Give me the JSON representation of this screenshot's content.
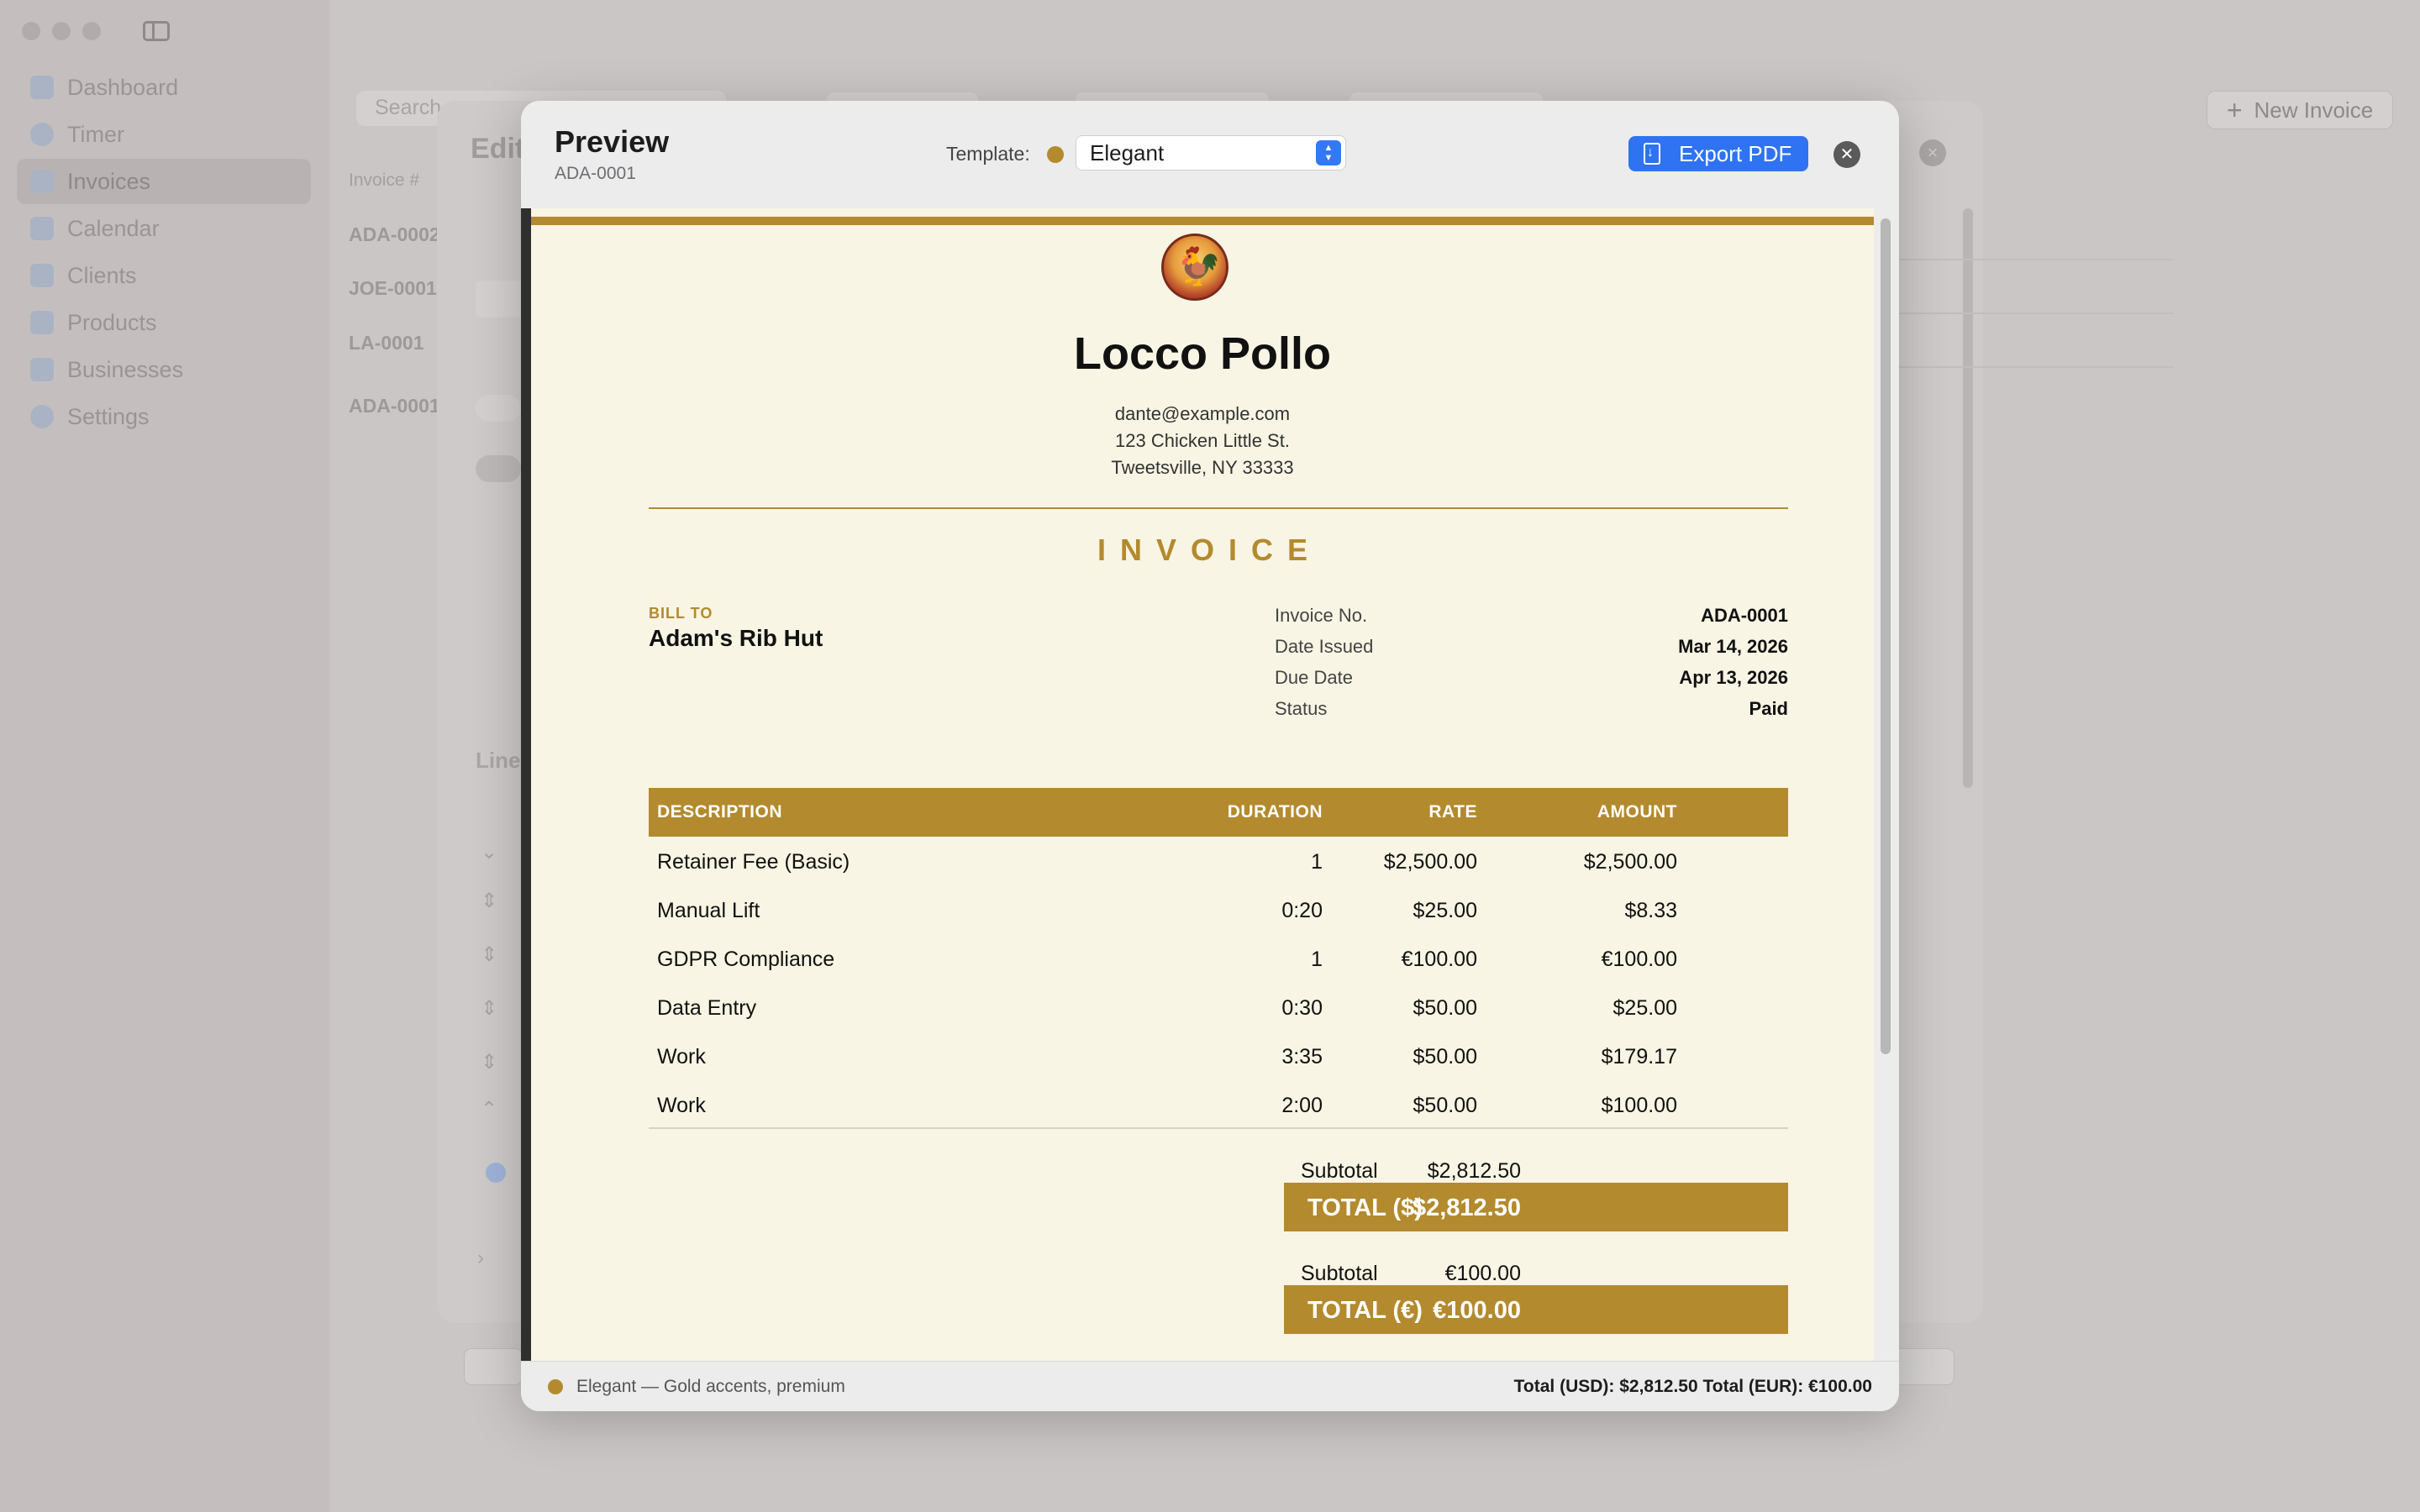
{
  "sidebar": {
    "items": [
      {
        "label": "Dashboard"
      },
      {
        "label": "Timer"
      },
      {
        "label": "Invoices"
      },
      {
        "label": "Calendar"
      },
      {
        "label": "Clients"
      },
      {
        "label": "Products"
      },
      {
        "label": "Businesses"
      },
      {
        "label": "Settings"
      }
    ],
    "active": "Invoices"
  },
  "background": {
    "search_placeholder": "Search",
    "new_invoice_label": "New Invoice",
    "column_label": "Invoice #",
    "invoice_list": [
      "ADA-0002",
      "JOE-0001",
      "LA-0001",
      "ADA-0001"
    ],
    "editor_title": "Edit"
  },
  "modal": {
    "title": "Preview",
    "subtitle": "ADA-0001",
    "template_label": "Template:",
    "template_value": "Elegant",
    "template_color": "#b38a2e",
    "export_label": "Export PDF",
    "close_icon": "close-icon"
  },
  "invoice": {
    "business_name": "Locco Pollo",
    "email": "dante@example.com",
    "address_line1": "123 Chicken Little St.",
    "address_line2": "Tweetsville, NY 33333",
    "heading": "INVOICE",
    "bill_to_label": "BILL TO",
    "bill_to_name": "Adam's Rib Hut",
    "meta": [
      {
        "key": "Invoice No.",
        "value": "ADA-0001"
      },
      {
        "key": "Date Issued",
        "value": "Mar 14, 2026"
      },
      {
        "key": "Due Date",
        "value": "Apr 13, 2026"
      },
      {
        "key": "Status",
        "value": "Paid"
      }
    ],
    "columns": {
      "description": "DESCRIPTION",
      "duration": "DURATION",
      "rate": "RATE",
      "amount": "AMOUNT"
    },
    "lines": [
      {
        "description": "Retainer Fee (Basic)",
        "duration": "1",
        "rate": "$2,500.00",
        "amount": "$2,500.00"
      },
      {
        "description": "Manual Lift",
        "duration": "0:20",
        "rate": "$25.00",
        "amount": "$8.33"
      },
      {
        "description": "GDPR Compliance",
        "duration": "1",
        "rate": "€100.00",
        "amount": "€100.00"
      },
      {
        "description": "Data Entry",
        "duration": "0:30",
        "rate": "$50.00",
        "amount": "$25.00"
      },
      {
        "description": "Work",
        "duration": "3:35",
        "rate": "$50.00",
        "amount": "$179.17"
      },
      {
        "description": "Work",
        "duration": "2:00",
        "rate": "$50.00",
        "amount": "$100.00"
      }
    ],
    "totals": [
      {
        "subtotal_label": "Subtotal",
        "subtotal": "$2,812.50",
        "total_label": "TOTAL ($)",
        "total": "$2,812.50"
      },
      {
        "subtotal_label": "Subtotal",
        "subtotal": "€100.00",
        "total_label": "TOTAL (€)",
        "total": "€100.00"
      }
    ],
    "accent_color": "#b38a2e"
  },
  "footer": {
    "template_desc": "Elegant — Gold accents, premium",
    "totals_text": "Total (USD): $2,812.50   Total (EUR): €100.00"
  }
}
